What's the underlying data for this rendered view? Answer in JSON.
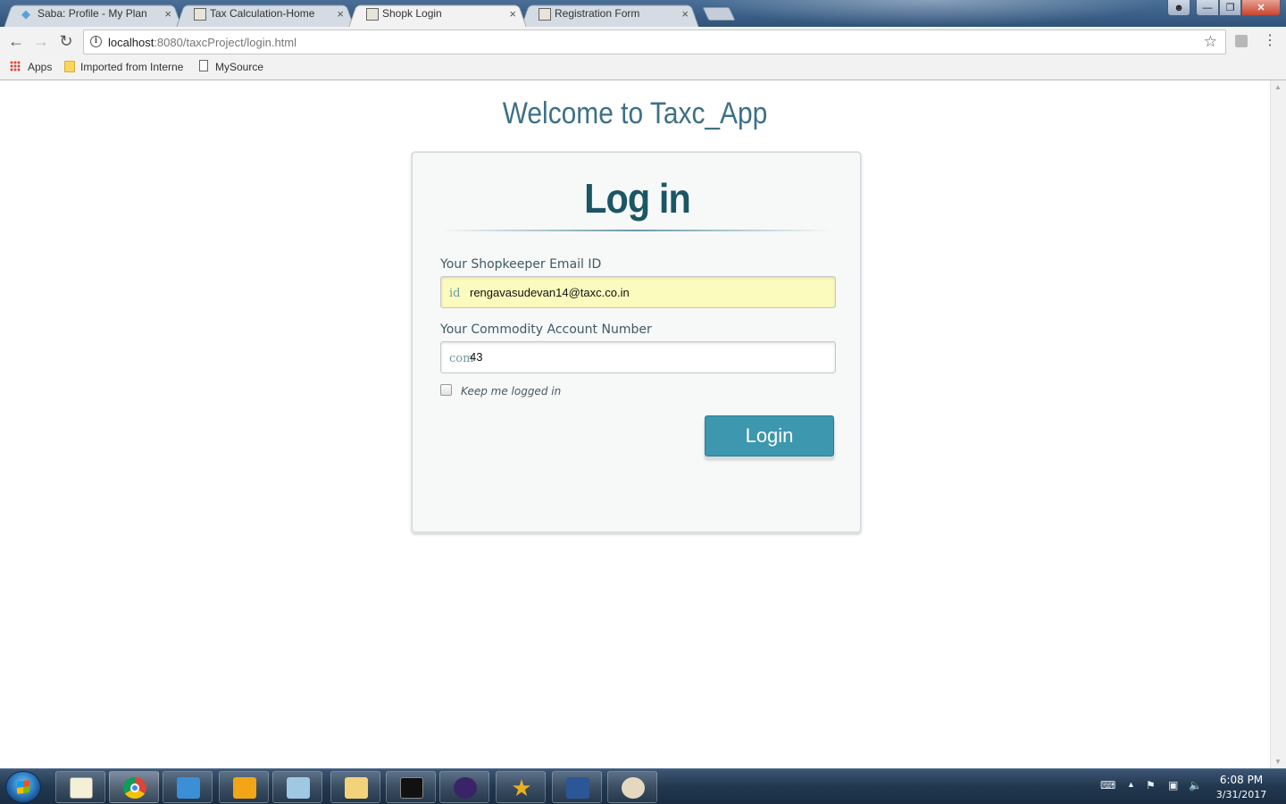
{
  "browser": {
    "tabs": [
      {
        "title": "Saba: Profile - My Plan",
        "active": false
      },
      {
        "title": "Tax Calculation-Home",
        "active": false
      },
      {
        "title": "Shopk Login",
        "active": true
      },
      {
        "title": "Registration Form",
        "active": false
      }
    ],
    "tab_close_glyph": "×",
    "address": {
      "host": "localhost",
      "path": ":8080/taxcProject/login.html"
    },
    "bookmarks": [
      {
        "label": "Apps",
        "icon": "apps-grid-icon"
      },
      {
        "label": "Imported from Interne",
        "icon": "folder-icon"
      },
      {
        "label": "MySource",
        "icon": "page-icon"
      }
    ]
  },
  "page": {
    "welcome": "Welcome to Taxc_App",
    "login": {
      "title": "Log in",
      "email_label": "Your Shopkeeper Email ID",
      "email_prefix": "id",
      "email_value": "rengavasudevan14@taxc.co.in",
      "account_label": "Your Commodity Account Number",
      "account_prefix": "com",
      "account_value": "43",
      "remember_label": "Keep me logged in",
      "remember_checked": false,
      "button_label": "Login"
    }
  },
  "taskbar": {
    "apps": [
      "notepad-icon",
      "chrome-icon",
      "lync-icon",
      "outlook-icon",
      "notebook-icon",
      "explorer-icon",
      "cmd-icon",
      "java-ee-ide-icon",
      "star-app-icon",
      "word-icon",
      "paint-icon"
    ],
    "time": "6:08 PM",
    "date": "3/31/2017"
  },
  "colors": {
    "accent": "#3d97ae",
    "title": "#1c5664",
    "welcome": "#3d7187",
    "autofill": "#fbfbbe"
  }
}
